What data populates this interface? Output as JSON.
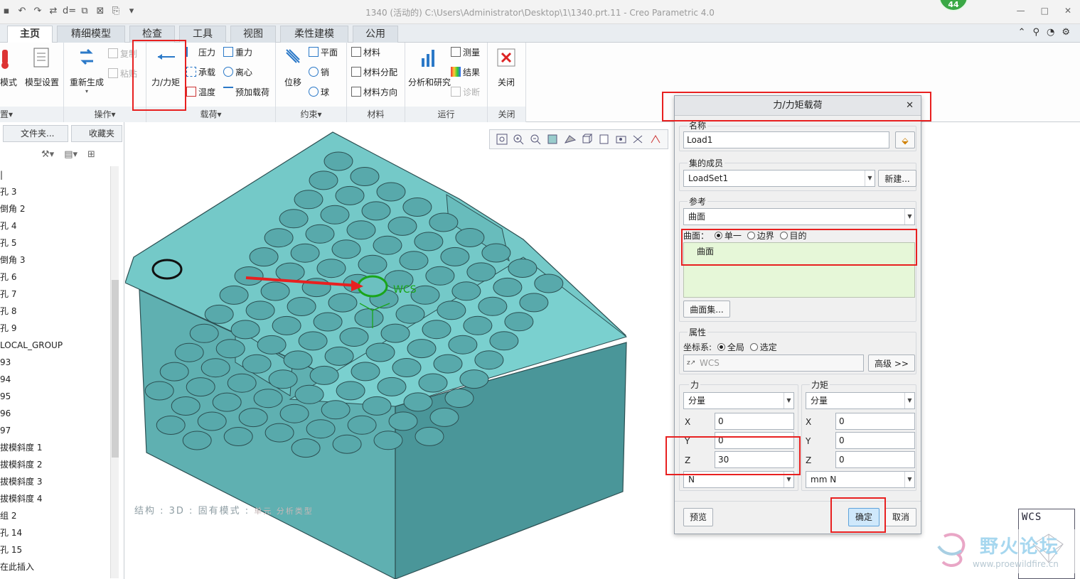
{
  "titlebar": {
    "title": "1340 (活动的) C:\\Users\\Administrator\\Desktop\\1\\1340.prt.11 - Creo Parametric 4.0",
    "badge": "44"
  },
  "tabs": [
    "主页",
    "精细模型",
    "检查",
    "工具",
    "视图",
    "柔性建模",
    "公用"
  ],
  "active_tab": "主页",
  "ribbon": {
    "setup": {
      "mode_label": "模式",
      "model_setup_label": "模型设置",
      "footer": "置▾"
    },
    "operations": {
      "regenerate_label": "重新生成",
      "copy_label": "复制",
      "paste_label": "粘贴",
      "footer": "操作▾"
    },
    "loads": {
      "force_moment_label": "力/力矩",
      "pressure_label": "压力",
      "bearing_label": "承载",
      "temperature_label": "温度",
      "gravity_label": "重力",
      "centrifugal_label": "离心",
      "preload_label": "预加载荷",
      "footer": "载荷▾"
    },
    "constraints": {
      "displacement_label": "位移",
      "plane_label": "平面",
      "pin_label": "销",
      "ball_label": "球",
      "footer": "约束▾"
    },
    "materials": {
      "material_label": "材料",
      "material_assign_label": "材料分配",
      "material_orient_label": "材料方向",
      "footer": "材料"
    },
    "run": {
      "analysis_label": "分析和研究",
      "measure_label": "测量",
      "results_label": "结果",
      "diagnose_label": "诊断",
      "footer": "运行"
    },
    "close": {
      "close_label": "关闭",
      "footer": "关闭"
    }
  },
  "leftpanel": {
    "tab_folder": "文件夹...",
    "tab_favorites": "收藏夹",
    "tree_items": [
      "|",
      "孔 3",
      "倒角 2",
      "孔 4",
      "孔 5",
      "倒角 3",
      "孔 6",
      "孔 7",
      "孔 8",
      "孔 9",
      "LOCAL_GROUP",
      "93",
      "94",
      "95",
      "96",
      "97",
      "拔模斜度 1",
      "拔模斜度 2",
      "拔模斜度 3",
      "拔模斜度 4",
      "组 2",
      "孔 14",
      "孔 15",
      "在此插入"
    ]
  },
  "graphics": {
    "status_text": "结构 : 3D : 固有模式 :",
    "status_extra": "单元  分析类型",
    "wcs_label": "WCS"
  },
  "dialog": {
    "title": "力/力矩载荷",
    "name_label": "名称",
    "name_value": "Load1",
    "set_member_label": "集的成员",
    "set_member_value": "LoadSet1",
    "new_button": "新建...",
    "reference_label": "参考",
    "reference_value": "曲面",
    "surface_mode_label": "曲面：",
    "mode_single": "单一",
    "mode_boundary": "边界",
    "mode_intent": "目的",
    "collector_item": "曲面",
    "surface_set_button": "曲面集...",
    "properties_label": "属性",
    "csys_label": "坐标系:",
    "csys_global": "全局",
    "csys_selected": "选定",
    "csys_value": "WCS",
    "advanced_button": "高级 >>",
    "force_label": "力",
    "moment_label": "力矩",
    "force_type": "分量",
    "moment_type": "分量",
    "force_x": "0",
    "force_y": "0",
    "force_z": "30",
    "moment_x": "0",
    "moment_y": "0",
    "moment_z": "0",
    "force_unit": "N",
    "moment_unit": "mm N",
    "axis_x": "X",
    "axis_y": "Y",
    "axis_z": "Z",
    "preview_button": "预览",
    "ok_button": "确定",
    "cancel_button": "取消"
  },
  "watermark": {
    "text": "野火论坛",
    "url": "www.proewildfire.cn"
  },
  "colors": {
    "model": "#6fc4c4",
    "model_dark": "#4f9c9e",
    "highlight": "#e82020",
    "ok_button": "#cfe8fb"
  }
}
